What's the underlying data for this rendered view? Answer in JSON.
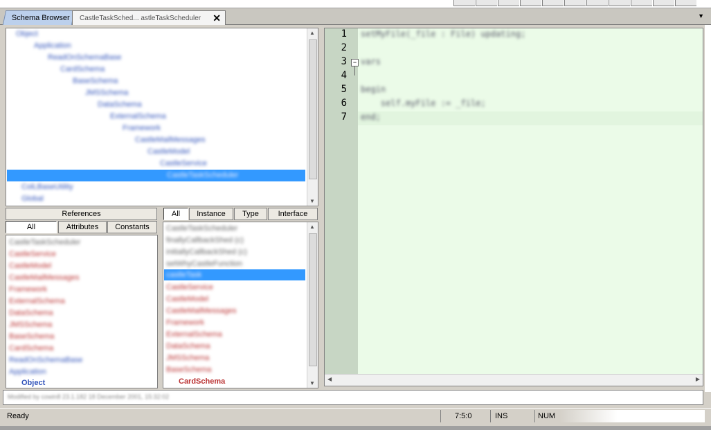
{
  "tabs": [
    {
      "label": "Schema Browser"
    },
    {
      "label": "CastleTaskSched...  astleTaskScheduler"
    }
  ],
  "tab_close_symbol": "✕",
  "tree": {
    "items": [
      {
        "label": "Object"
      },
      {
        "label": "Application"
      },
      {
        "label": "ReadOnSchemaBase"
      },
      {
        "label": "CardSchema"
      },
      {
        "label": "BaseSchema"
      },
      {
        "label": "JMSSchema"
      },
      {
        "label": "DataSchema"
      },
      {
        "label": "ExternalSchema"
      },
      {
        "label": "Framework"
      },
      {
        "label": "CastleMailMessages"
      },
      {
        "label": "CastleModel"
      },
      {
        "label": "CastleService"
      },
      {
        "label": "CastleTaskScheduler"
      },
      {
        "label": "ColLBaseUtility"
      },
      {
        "label": "Global"
      }
    ]
  },
  "left_panel": {
    "references_label": "References",
    "tabs": [
      "All",
      "Attributes",
      "Constants"
    ],
    "items": [
      {
        "label": "CastleTaskScheduler"
      },
      {
        "label": "CastleService"
      },
      {
        "label": "CastleModel"
      },
      {
        "label": "CastleMailMessages"
      },
      {
        "label": "Framework"
      },
      {
        "label": "ExternalSchema"
      },
      {
        "label": "DataSchema"
      },
      {
        "label": "JMSSchema"
      },
      {
        "label": "BaseSchema"
      },
      {
        "label": "CardSchema"
      },
      {
        "label": "ReadOnSchemaBase"
      },
      {
        "label": "Application"
      },
      {
        "label": "Object"
      }
    ]
  },
  "right_panel": {
    "tabs": [
      "All",
      "Instance",
      "Type",
      "Interface"
    ],
    "items": [
      {
        "label": "CastleTaskScheduler"
      },
      {
        "label": "finallyCallbackShed (c)"
      },
      {
        "label": "initiallyCallbackShed (c)"
      },
      {
        "label": "setWhyCastleFunction"
      },
      {
        "label": "castleTask"
      },
      {
        "label": "CastleService"
      },
      {
        "label": "CastleModel"
      },
      {
        "label": "CastleMailMessages"
      },
      {
        "label": "Framework"
      },
      {
        "label": "ExternalSchema"
      },
      {
        "label": "DataSchema"
      },
      {
        "label": "JMSSchema"
      },
      {
        "label": "BaseSchema"
      },
      {
        "label": "CardSchema"
      }
    ]
  },
  "editor": {
    "lines": [
      "1",
      "2",
      "3",
      "4",
      "5",
      "6",
      "7"
    ],
    "code": [
      "setMyFile(_file : File) updating;",
      "",
      "vars",
      "",
      "begin",
      "    self.myFile := _file;",
      "end;"
    ]
  },
  "message_bar": "Modified by cowin8 23.1.182 18 December 2001, 15:32:02",
  "status": {
    "ready": "Ready",
    "position": "7:5:0",
    "ins": "INS",
    "num": "NUM"
  }
}
